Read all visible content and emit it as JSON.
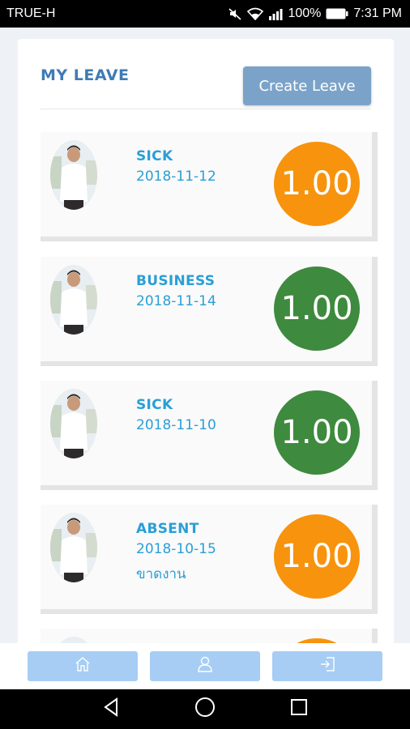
{
  "status_bar": {
    "carrier": "TRUE-H",
    "battery": "100%",
    "time": "7:31 PM",
    "icons": [
      "mute-icon",
      "wifi-icon",
      "signal-icon",
      "battery-icon"
    ]
  },
  "header": {
    "title": "MY LEAVE",
    "create_button": "Create Leave"
  },
  "leaves": [
    {
      "type": "SICK",
      "date": "2018-11-12",
      "note": "",
      "amount": "1.00",
      "color": "#f7930d"
    },
    {
      "type": "BUSINESS",
      "date": "2018-11-14",
      "note": "",
      "amount": "1.00",
      "color": "#3e8a3e"
    },
    {
      "type": "SICK",
      "date": "2018-11-10",
      "note": "",
      "amount": "1.00",
      "color": "#3e8a3e"
    },
    {
      "type": "ABSENT",
      "date": "2018-10-15",
      "note": "ขาดงาน",
      "amount": "1.00",
      "color": "#f7930d"
    },
    {
      "type": "",
      "date": "",
      "note": "",
      "amount": "",
      "color": "#f7930d"
    }
  ],
  "bottom_nav": {
    "items": [
      "home-icon",
      "profile-icon",
      "logout-icon"
    ]
  },
  "colors": {
    "accent_blue": "#3f7bb4",
    "text_blue": "#2a9fd6",
    "button_blue": "#7ba3c9",
    "nav_blue": "#a7cdf4",
    "orange": "#f7930d",
    "green": "#3e8a3e"
  }
}
